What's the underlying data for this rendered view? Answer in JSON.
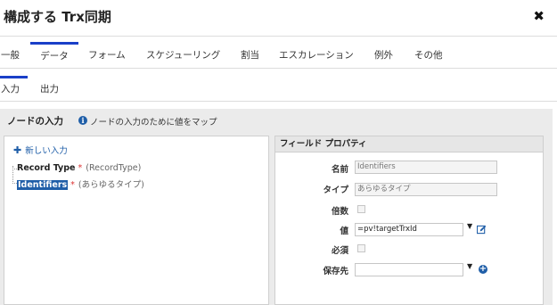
{
  "window": {
    "title": "構成する Trx同期",
    "close_glyph": "✖"
  },
  "tabs": [
    {
      "label": "一般",
      "active": false
    },
    {
      "label": "データ",
      "active": true
    },
    {
      "label": "フォーム",
      "active": false
    },
    {
      "label": "スケジューリング",
      "active": false
    },
    {
      "label": "割当",
      "active": false
    },
    {
      "label": "エスカレーション",
      "active": false
    },
    {
      "label": "例外",
      "active": false
    },
    {
      "label": "その他",
      "active": false
    }
  ],
  "subtabs": [
    {
      "label": "入力",
      "active": true
    },
    {
      "label": "出力",
      "active": false
    }
  ],
  "section": {
    "title": "ノードの入力",
    "info": "ノードの入力のために値をマップ"
  },
  "tree": {
    "new_input": "新しい入力",
    "nodes": [
      {
        "name": "Record Type",
        "required": "*",
        "type": "(RecordType)",
        "selected": false
      },
      {
        "name": "Identifiers",
        "required": "*",
        "type": "(あらゆるタイプ)",
        "selected": true
      }
    ]
  },
  "properties": {
    "header": "フィールド プロパティ",
    "name_label": "名前",
    "name_value": "Identifiers",
    "type_label": "タイプ",
    "type_value": "あらゆるタイプ",
    "multiple_label": "倍数",
    "value_label": "値",
    "value_value": "=pv!targetTrxId",
    "required_label": "必須",
    "saveto_label": "保存先",
    "saveto_value": ""
  },
  "colors": {
    "accent": "#1a3fc8",
    "link": "#1f5ea8",
    "selection": "#1f5ea8",
    "required": "#dd3333"
  }
}
